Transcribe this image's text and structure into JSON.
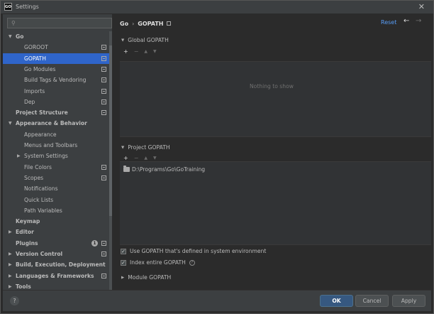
{
  "window": {
    "title": "Settings",
    "app_icon_text": "GO"
  },
  "search": {
    "placeholder": ""
  },
  "sidebar": {
    "items": [
      {
        "label": "Go",
        "level": 0,
        "arrow": "down",
        "bold": true
      },
      {
        "label": "GOROOT",
        "level": 1,
        "module_icon": true
      },
      {
        "label": "GOPATH",
        "level": 1,
        "module_icon": true,
        "selected": true
      },
      {
        "label": "Go Modules",
        "level": 1,
        "module_icon": true
      },
      {
        "label": "Build Tags & Vendoring",
        "level": 1,
        "module_icon": true
      },
      {
        "label": "Imports",
        "level": 1,
        "module_icon": true
      },
      {
        "label": "Dep",
        "level": 1,
        "module_icon": true
      },
      {
        "label": "Project Structure",
        "level": 0,
        "bold": true,
        "module_icon": true
      },
      {
        "label": "Appearance & Behavior",
        "level": 0,
        "arrow": "down",
        "bold": true
      },
      {
        "label": "Appearance",
        "level": 1
      },
      {
        "label": "Menus and Toolbars",
        "level": 1
      },
      {
        "label": "System Settings",
        "level": 1,
        "arrow": "right"
      },
      {
        "label": "File Colors",
        "level": 1,
        "module_icon": true
      },
      {
        "label": "Scopes",
        "level": 1,
        "module_icon": true
      },
      {
        "label": "Notifications",
        "level": 1
      },
      {
        "label": "Quick Lists",
        "level": 1
      },
      {
        "label": "Path Variables",
        "level": 1
      },
      {
        "label": "Keymap",
        "level": 0,
        "bold": true
      },
      {
        "label": "Editor",
        "level": 0,
        "arrow": "right",
        "bold": true
      },
      {
        "label": "Plugins",
        "level": 0,
        "bold": true,
        "module_icon": true,
        "badge": "1"
      },
      {
        "label": "Version Control",
        "level": 0,
        "arrow": "right",
        "bold": true,
        "module_icon": true
      },
      {
        "label": "Build, Execution, Deployment",
        "level": 0,
        "arrow": "right",
        "bold": true
      },
      {
        "label": "Languages & Frameworks",
        "level": 0,
        "arrow": "right",
        "bold": true,
        "module_icon": true
      },
      {
        "label": "Tools",
        "level": 0,
        "arrow": "right",
        "bold": true
      }
    ]
  },
  "breadcrumb": {
    "parent": "Go",
    "separator": "›",
    "current": "GOPATH"
  },
  "header": {
    "reset_label": "Reset",
    "back_glyph": "←",
    "forward_glyph": "→"
  },
  "global_gopath": {
    "title": "Global GOPATH",
    "empty_text": "Nothing to show"
  },
  "project_gopath": {
    "title": "Project GOPATH",
    "paths": [
      "D:\\Programs\\Go\\GoTraining"
    ]
  },
  "toolbar": {
    "add": "+",
    "remove": "−",
    "up": "▲",
    "down": "▼"
  },
  "options": {
    "use_system_gopath": {
      "label": "Use GOPATH that's defined in system environment",
      "checked": true
    },
    "index_entire_gopath": {
      "label": "Index entire GOPATH",
      "checked": true
    }
  },
  "module_gopath": {
    "title": "Module GOPATH"
  },
  "footer": {
    "help": "?",
    "ok_label": "OK",
    "cancel_label": "Cancel",
    "apply_label": "Apply"
  },
  "colors": {
    "selection": "#2f65ca",
    "link": "#589df6",
    "primary_button": "#365880"
  }
}
